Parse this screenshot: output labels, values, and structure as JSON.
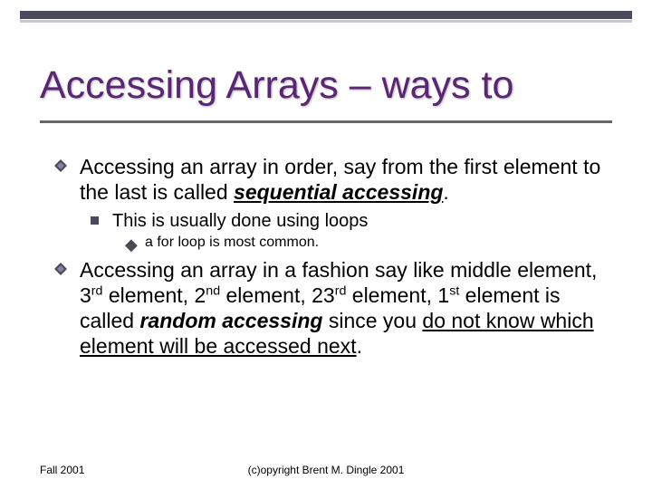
{
  "title": "Accessing Arrays – ways to",
  "p1": {
    "a": "Accessing an array in order, say from the first element to the last is called ",
    "term": "sequential accessing",
    "b": "."
  },
  "p2": "This is usually done using loops",
  "p3": "a for loop is most common.",
  "p4": {
    "a": "Accessing an array in a fashion say like middle element, 3",
    "s1": "rd",
    "b": " element, 2",
    "s2": "nd",
    "c": " element, 23",
    "s3": "rd",
    "d": " element, 1",
    "s4": "st",
    "e": " element is called ",
    "term": "random accessing",
    "f": " since you ",
    "ul": "do not know which element will be accessed next",
    "g": "."
  },
  "footer": {
    "left": "Fall 2001",
    "center": "(c)opyright Brent M. Dingle 2001"
  }
}
